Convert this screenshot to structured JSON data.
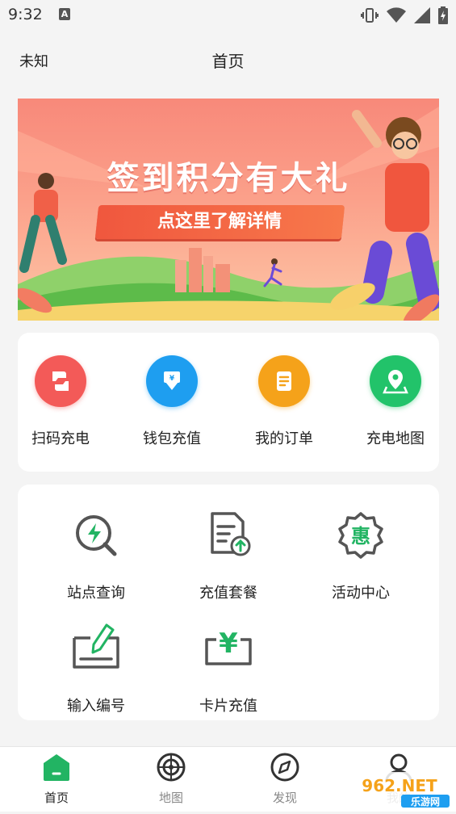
{
  "status_bar": {
    "time": "9:32",
    "notification_icon": "A"
  },
  "header": {
    "location": "未知",
    "title": "首页"
  },
  "banner": {
    "headline": "签到积分有大礼",
    "cta": "点这里了解详情"
  },
  "quick_actions": [
    {
      "label": "扫码充电",
      "icon": "scan-icon",
      "color": "#f25c5c"
    },
    {
      "label": "钱包充值",
      "icon": "wallet-topup-icon",
      "color": "#1e9ef0"
    },
    {
      "label": "我的订单",
      "icon": "order-icon",
      "color": "#f5a21a"
    },
    {
      "label": "充电地图",
      "icon": "map-pin-icon",
      "color": "#22c36a"
    }
  ],
  "services": [
    {
      "label": "站点查询",
      "icon": "station-search-icon"
    },
    {
      "label": "充值套餐",
      "icon": "recharge-package-icon"
    },
    {
      "label": "活动中心",
      "icon": "promotion-badge-icon",
      "badge_text": "惠"
    },
    {
      "label": "输入编号",
      "icon": "input-number-icon"
    },
    {
      "label": "卡片充值",
      "icon": "card-recharge-icon",
      "badge_text": "¥"
    }
  ],
  "accent_color": "#22b463",
  "bottom_nav": [
    {
      "label": "首页",
      "icon": "home-icon",
      "active": true
    },
    {
      "label": "地图",
      "icon": "radar-map-icon",
      "active": false
    },
    {
      "label": "发现",
      "icon": "compass-icon",
      "active": false
    },
    {
      "label": "我的",
      "icon": "profile-icon",
      "active": false
    }
  ],
  "watermark": {
    "text": "962.NET",
    "subtext": "乐游网"
  }
}
